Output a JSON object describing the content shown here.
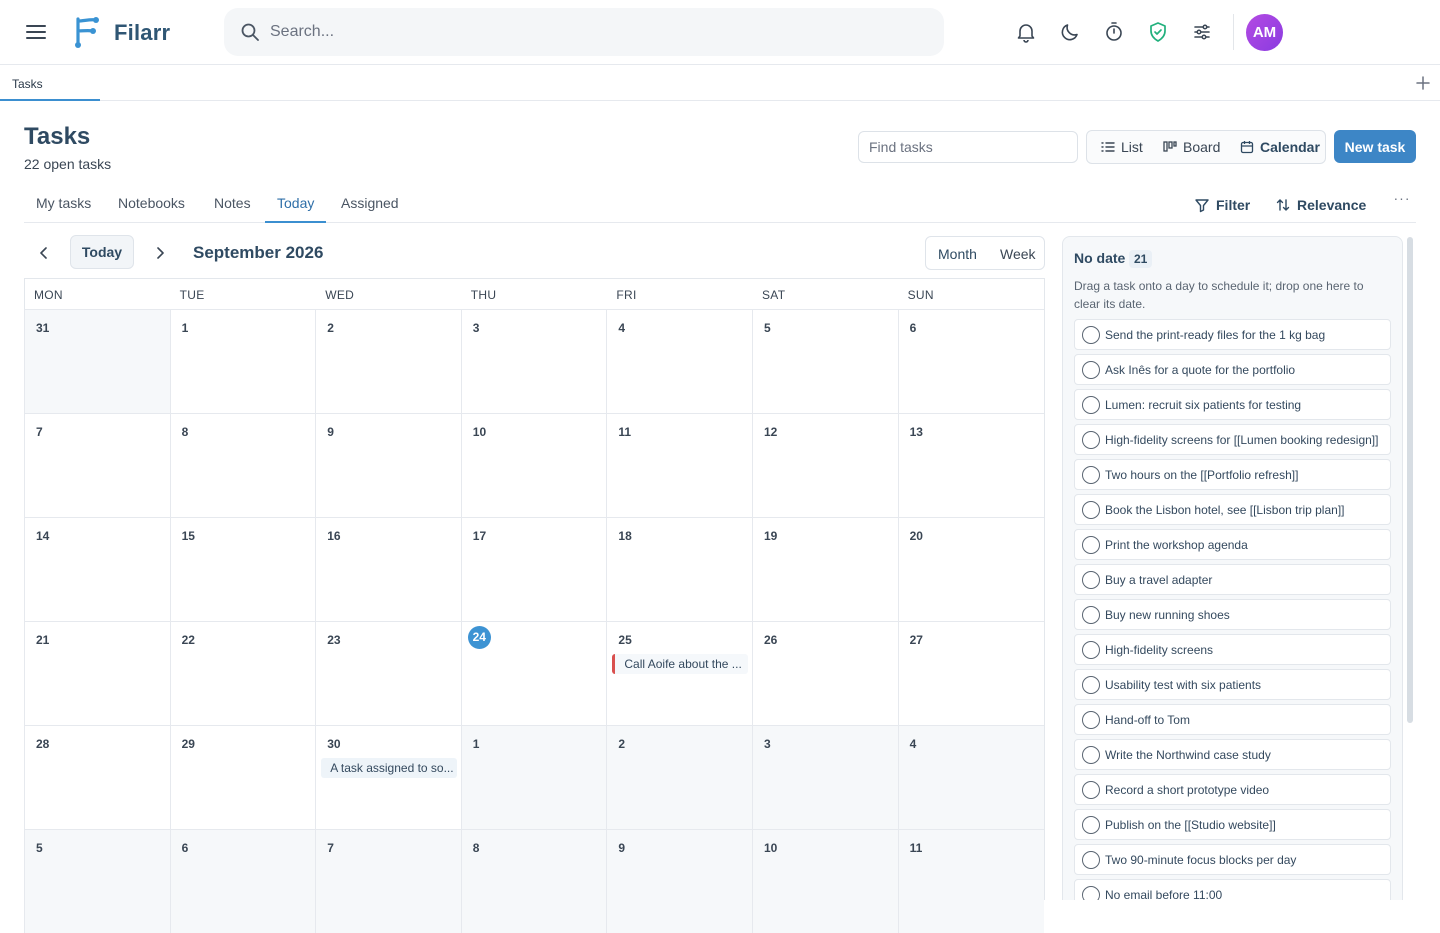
{
  "app": {
    "name": "Filarr",
    "avatar_initials": "AM",
    "search_placeholder": "Search..."
  },
  "icons": {
    "menu": "menu-icon",
    "bell": "bell-icon",
    "moon": "moon-icon",
    "timer": "timer-icon",
    "shield": "shield-check-icon",
    "sliders": "sliders-icon",
    "plus": "plus-icon"
  },
  "colors": {
    "accent": "#3d86c6",
    "today": "#3d93d3",
    "shield": "#22b07d",
    "event_flag": "#d9504e",
    "avatar": "#a044e2"
  },
  "tabstrip": {
    "tab": "Tasks"
  },
  "header": {
    "title": "Tasks",
    "subtitle": "22 open tasks",
    "find_placeholder": "Find tasks",
    "views": [
      "List",
      "Board",
      "Calendar"
    ],
    "active_view": "Calendar",
    "new_task": "New task"
  },
  "subtabs": {
    "items": [
      "My tasks",
      "Notebooks",
      "Notes",
      "Today",
      "Assigned"
    ],
    "active": "Today",
    "filter": "Filter",
    "sort": "Relevance",
    "more": "···"
  },
  "calendar": {
    "today_button": "Today",
    "title": "September 2026",
    "modes": [
      "Month",
      "Week"
    ],
    "active_mode": "Month",
    "weekdays": [
      "MON",
      "TUE",
      "WED",
      "THU",
      "FRI",
      "SAT",
      "SUN"
    ],
    "weeks": [
      [
        {
          "d": "31",
          "out": true
        },
        {
          "d": "1"
        },
        {
          "d": "2"
        },
        {
          "d": "3"
        },
        {
          "d": "4"
        },
        {
          "d": "5"
        },
        {
          "d": "6"
        }
      ],
      [
        {
          "d": "7"
        },
        {
          "d": "8"
        },
        {
          "d": "9"
        },
        {
          "d": "10"
        },
        {
          "d": "11"
        },
        {
          "d": "12"
        },
        {
          "d": "13"
        }
      ],
      [
        {
          "d": "14"
        },
        {
          "d": "15"
        },
        {
          "d": "16"
        },
        {
          "d": "17"
        },
        {
          "d": "18"
        },
        {
          "d": "19"
        },
        {
          "d": "20"
        }
      ],
      [
        {
          "d": "21"
        },
        {
          "d": "22"
        },
        {
          "d": "23"
        },
        {
          "d": "24",
          "today": true
        },
        {
          "d": "25",
          "event": "Call Aoife about the ...",
          "event_style": "red"
        },
        {
          "d": "26"
        },
        {
          "d": "27"
        }
      ],
      [
        {
          "d": "28"
        },
        {
          "d": "29"
        },
        {
          "d": "30",
          "event": "A task assigned to so...",
          "event_style": "blue"
        },
        {
          "d": "1",
          "out": true
        },
        {
          "d": "2",
          "out": true
        },
        {
          "d": "3",
          "out": true
        },
        {
          "d": "4",
          "out": true
        }
      ],
      [
        {
          "d": "5",
          "out": true
        },
        {
          "d": "6",
          "out": true
        },
        {
          "d": "7",
          "out": true
        },
        {
          "d": "8",
          "out": true
        },
        {
          "d": "9",
          "out": true
        },
        {
          "d": "10",
          "out": true
        },
        {
          "d": "11",
          "out": true
        }
      ]
    ]
  },
  "no_date": {
    "title": "No date",
    "count": "21",
    "hint": "Drag a task onto a day to schedule it; drop one here to clear its date.",
    "tasks": [
      "Send the print-ready files for the 1 kg bag",
      "Ask Inês for a quote for the portfolio",
      "Lumen: recruit six patients for testing",
      "High-fidelity screens for [[Lumen booking redesign]]",
      "Two hours on the [[Portfolio refresh]]",
      "Book the Lisbon hotel, see [[Lisbon trip plan]]",
      "Print the workshop agenda",
      "Buy a travel adapter",
      "Buy new running shoes",
      "High-fidelity screens",
      "Usability test with six patients",
      "Hand-off to Tom",
      "Write the Northwind case study",
      "Record a short prototype video",
      "Publish on the [[Studio website]]",
      "Two 90-minute focus blocks per day",
      "No email before 11:00"
    ]
  }
}
